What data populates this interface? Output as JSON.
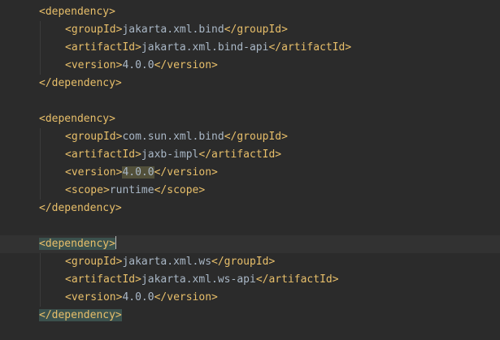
{
  "colors": {
    "background": "#2b2b2b",
    "tag": "#e8bf6a",
    "text": "#a9b7c6",
    "current_line": "#323232",
    "matched_tag_highlight": "#3b514d",
    "usage_highlight": "#52503a",
    "intention_bulb": "#f0a732"
  },
  "gutter": {
    "icon": "intention-bulb-icon"
  },
  "block1": {
    "open": "<dependency>",
    "group_open": "<groupId>",
    "group_val": "jakarta.xml.bind",
    "group_close": "</groupId>",
    "artifact_open": "<artifactId>",
    "artifact_val": "jakarta.xml.bind-api",
    "artifact_close": "</artifactId>",
    "version_open": "<version>",
    "version_val": "4.0.0",
    "version_close": "</version>",
    "close": "</dependency>"
  },
  "block2": {
    "open": "<dependency>",
    "group_open": "<groupId>",
    "group_val": "com.sun.xml.bind",
    "group_close": "</groupId>",
    "artifact_open": "<artifactId>",
    "artifact_val": "jaxb-impl",
    "artifact_close": "</artifactId>",
    "version_open": "<version>",
    "version_val": "4.0.0",
    "version_close": "</version>",
    "scope_open": "<scope>",
    "scope_val": "runtime",
    "scope_close": "</scope>",
    "close": "</dependency>"
  },
  "block3": {
    "open": "<dependency>",
    "group_open": "<groupId>",
    "group_val": "jakarta.xml.ws",
    "group_close": "</groupId>",
    "artifact_open": "<artifactId>",
    "artifact_val": "jakarta.xml.ws-api",
    "artifact_close": "</artifactId>",
    "version_open": "<version>",
    "version_val": "4.0.0",
    "version_close": "</version>",
    "close": "</dependency>"
  }
}
